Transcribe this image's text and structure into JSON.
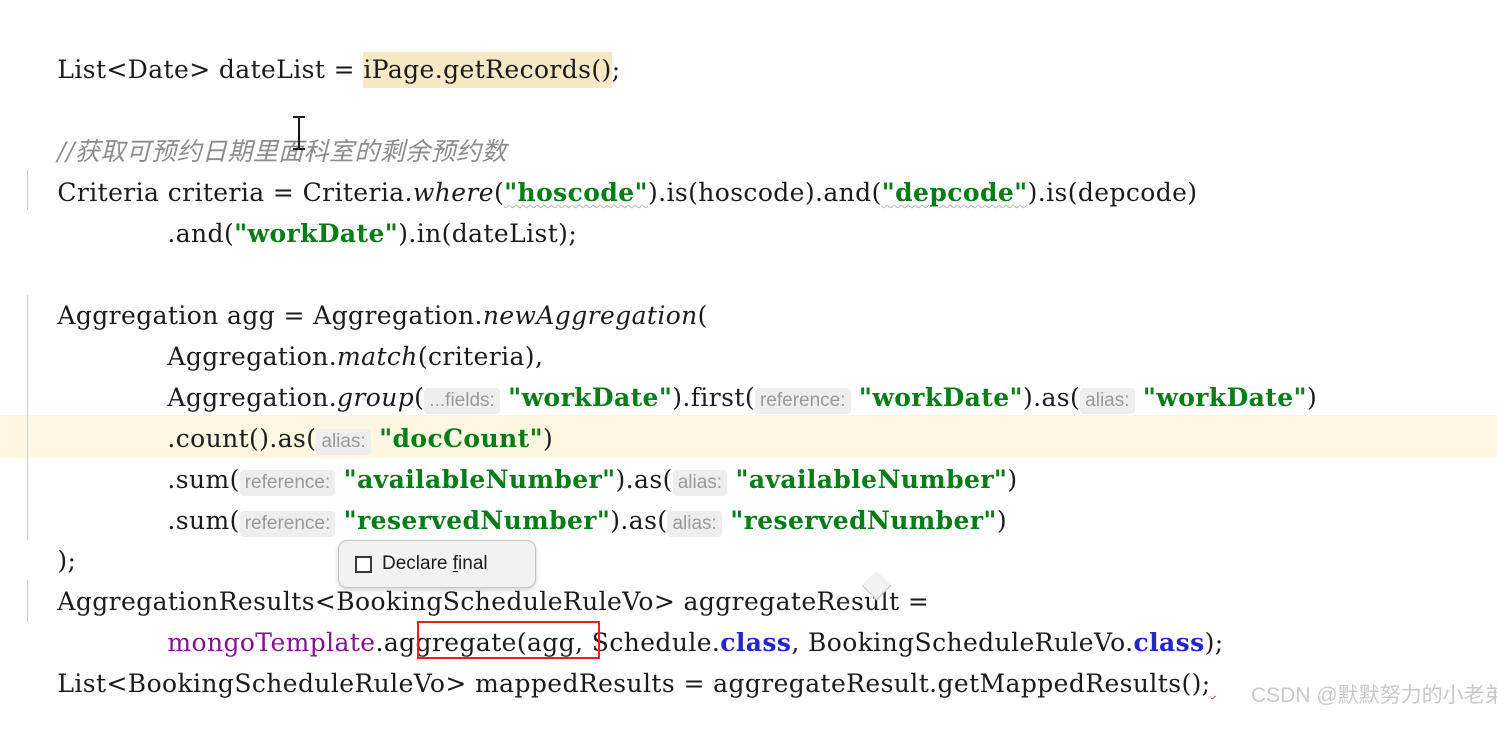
{
  "editor": {
    "background_color": "#ffffff",
    "current_line_highlight_color": "#fdf6e0",
    "selection_color": "#f6e8c4",
    "indent_guide_color": "#d3d3d3",
    "token_colors": {
      "plain": "#1b1b1b",
      "string": "#067d17",
      "keyword": "#2525cc",
      "field": "#871094",
      "comment": "#8c8c8c",
      "hint_text": "#9a9a9a",
      "hint_background": "#eeeeee",
      "annotation_red": "#e8201f"
    },
    "lines": [
      {
        "id": "line-1",
        "tokens": [
          {
            "text": "List<Date> dateList = ",
            "style": "plain"
          },
          {
            "text": "iPage.getRecords()",
            "style": "selection"
          },
          {
            "text": ";",
            "style": "plain"
          }
        ]
      },
      {
        "id": "line-2",
        "tokens": [
          {
            "text": "//获取可预约日期里面科室的剩余预约数",
            "style": "comment"
          }
        ]
      },
      {
        "id": "line-3",
        "tokens": [
          {
            "text": "Criteria criteria = Criteria.",
            "style": "plain"
          },
          {
            "text": "where",
            "style": "static"
          },
          {
            "text": "(",
            "style": "plain"
          },
          {
            "text": "\"hoscode\"",
            "style": "string-spell"
          },
          {
            "text": ").is(hoscode).and(",
            "style": "plain"
          },
          {
            "text": "\"depcode\"",
            "style": "string-spell"
          },
          {
            "text": ").is(depcode)",
            "style": "plain"
          }
        ]
      },
      {
        "id": "line-4",
        "tokens": [
          {
            "text": ".and(",
            "style": "plain"
          },
          {
            "text": "\"workDate\"",
            "style": "string"
          },
          {
            "text": ").in(dateList);",
            "style": "plain"
          }
        ]
      },
      {
        "id": "line-5",
        "tokens": [
          {
            "text": "Aggregation agg = Aggregation.",
            "style": "plain"
          },
          {
            "text": "newAggregation",
            "style": "static"
          },
          {
            "text": "(",
            "style": "plain"
          }
        ]
      },
      {
        "id": "line-6",
        "tokens": [
          {
            "text": "Aggregation.",
            "style": "plain"
          },
          {
            "text": "match",
            "style": "static"
          },
          {
            "text": "(criteria),",
            "style": "plain"
          }
        ]
      },
      {
        "id": "line-7",
        "tokens": [
          {
            "text": "Aggregation.",
            "style": "plain"
          },
          {
            "text": "group",
            "style": "static"
          },
          {
            "text": "(",
            "style": "plain"
          },
          {
            "text": "...fields:",
            "style": "hint"
          },
          {
            "text": " ",
            "style": "plain"
          },
          {
            "text": "\"workDate\"",
            "style": "string"
          },
          {
            "text": ").first(",
            "style": "plain"
          },
          {
            "text": "reference:",
            "style": "hint"
          },
          {
            "text": " ",
            "style": "plain"
          },
          {
            "text": "\"workDate\"",
            "style": "string"
          },
          {
            "text": ").as(",
            "style": "plain"
          },
          {
            "text": "alias:",
            "style": "hint"
          },
          {
            "text": " ",
            "style": "plain"
          },
          {
            "text": "\"workDate\"",
            "style": "string"
          },
          {
            "text": ")",
            "style": "plain"
          }
        ]
      },
      {
        "id": "line-8",
        "tokens": [
          {
            "text": ".count().as(",
            "style": "plain"
          },
          {
            "text": "alias:",
            "style": "hint"
          },
          {
            "text": " ",
            "style": "plain"
          },
          {
            "text": "\"docCount\"",
            "style": "string"
          },
          {
            "text": ")",
            "style": "plain"
          }
        ]
      },
      {
        "id": "line-9",
        "tokens": [
          {
            "text": ".sum(",
            "style": "plain"
          },
          {
            "text": "reference:",
            "style": "hint"
          },
          {
            "text": " ",
            "style": "plain"
          },
          {
            "text": "\"availableNumber\"",
            "style": "string"
          },
          {
            "text": ").as(",
            "style": "plain"
          },
          {
            "text": "alias:",
            "style": "hint"
          },
          {
            "text": " ",
            "style": "plain"
          },
          {
            "text": "\"availableNumber\"",
            "style": "string"
          },
          {
            "text": ")",
            "style": "plain"
          }
        ]
      },
      {
        "id": "line-10",
        "tokens": [
          {
            "text": ".sum(",
            "style": "plain"
          },
          {
            "text": "reference:",
            "style": "hint"
          },
          {
            "text": " ",
            "style": "plain"
          },
          {
            "text": "\"reservedNumber\"",
            "style": "string"
          },
          {
            "text": ").as(",
            "style": "plain"
          },
          {
            "text": "alias:",
            "style": "hint"
          },
          {
            "text": " ",
            "style": "plain"
          },
          {
            "text": "\"reservedNumber\"",
            "style": "string"
          },
          {
            "text": ")",
            "style": "plain"
          }
        ]
      },
      {
        "id": "line-11",
        "tokens": [
          {
            "text": ");",
            "style": "plain"
          }
        ]
      },
      {
        "id": "line-12",
        "tokens": [
          {
            "text": "AggregationResults<BookingScheduleRuleVo> aggregateResult =",
            "style": "plain"
          }
        ]
      },
      {
        "id": "line-13",
        "tokens": [
          {
            "text": "mongoTemplate",
            "style": "field"
          },
          {
            "text": ".aggregate(agg, Schedule.",
            "style": "plain"
          },
          {
            "text": "class",
            "style": "keyword"
          },
          {
            "text": ", BookingScheduleRuleVo.",
            "style": "plain"
          },
          {
            "text": "class",
            "style": "keyword"
          },
          {
            "text": ");",
            "style": "plain"
          }
        ]
      },
      {
        "id": "line-14",
        "tokens": [
          {
            "text": "List<BookingScheduleRuleVo> mappedResults = aggregateResult.getMappedResults();",
            "style": "plain"
          },
          {
            "text": " ",
            "style": "spell-red"
          }
        ]
      }
    ]
  },
  "popup": {
    "label_prefix": "Declare ",
    "label_mnemonic": "f",
    "label_suffix": "inal",
    "checkbox_checked": false
  },
  "annotations": {
    "red_box_target": "mappedResults"
  },
  "watermark": {
    "text": "CSDN @默默努力的小老弟"
  },
  "cursor": {
    "type": "i-beam-text-cursor"
  }
}
